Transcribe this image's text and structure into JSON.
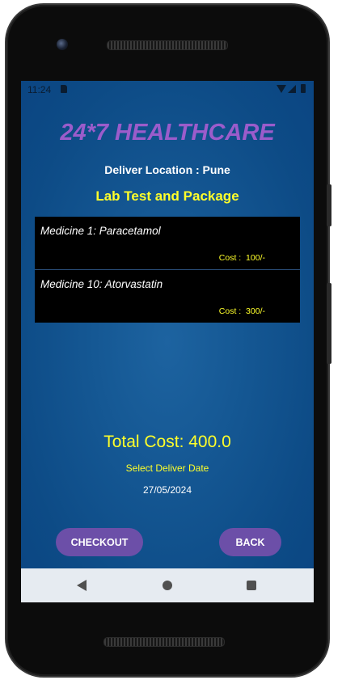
{
  "status_bar": {
    "time": "11:24"
  },
  "app": {
    "title": "24*7 HEALTHCARE",
    "deliver_location": "Deliver Location : Pune",
    "section_title": "Lab Test and Package"
  },
  "items": [
    {
      "name": "Medicine 1: Paracetamol",
      "cost": "Cost :  100/-"
    },
    {
      "name": "Medicine 10: Atorvastatin",
      "cost": "Cost :  300/-"
    }
  ],
  "total_cost": "Total Cost: 400.0",
  "deliver_date": {
    "label": "Select Deliver Date",
    "value": "27/05/2024"
  },
  "buttons": {
    "checkout": "CHECKOUT",
    "back": "BACK"
  },
  "colors": {
    "title": "#9b5ccb",
    "accent_yellow": "#ffff2a",
    "background": "#155894",
    "button": "#6c4fa8"
  },
  "icons": {
    "status_bar": [
      "sd-card-icon",
      "wifi-icon",
      "signal-icon",
      "battery-icon"
    ],
    "nav_bar": [
      "nav-back-icon",
      "nav-home-icon",
      "nav-recents-icon"
    ]
  }
}
